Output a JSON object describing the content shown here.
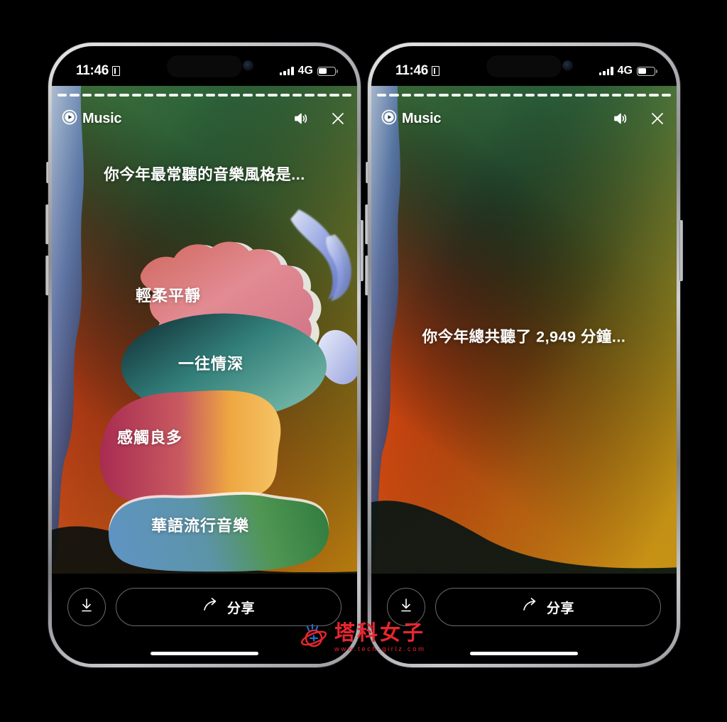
{
  "statusbar": {
    "time": "11:46",
    "network": "4G",
    "book_icon": "book-icon",
    "signal_icon": "signal-bars-icon",
    "battery_icon": "battery-icon"
  },
  "story": {
    "brand": "Music",
    "brand_icon": "apple-music-play-icon",
    "volume_icon": "volume-icon",
    "close_icon": "close-icon",
    "segments": 24
  },
  "left_screen": {
    "headline": "你今年最常聽的音樂風格是...",
    "blobs": [
      {
        "label": "輕柔平靜",
        "color": "#e0849a"
      },
      {
        "label": "一往情深",
        "color": "#3f8d86"
      },
      {
        "label": "感觸良多",
        "color": "#b4335a"
      },
      {
        "label": "華語流行音樂",
        "color": "#5b8fb9"
      }
    ]
  },
  "right_screen": {
    "headline": "你今年總共聽了 2,949 分鐘...",
    "minutes": "2,949"
  },
  "bottombar": {
    "download_icon": "download-icon",
    "share_icon": "share-arrow-icon",
    "share_label": "分享"
  },
  "watermark": {
    "logo_icon": "planet-logo-icon",
    "name": "塔科女子",
    "url": "www.tech-girlz.com"
  },
  "colors": {
    "accent_red": "#e8262f",
    "screen_black": "#000000",
    "frame_silver": "#c8c9cc"
  }
}
